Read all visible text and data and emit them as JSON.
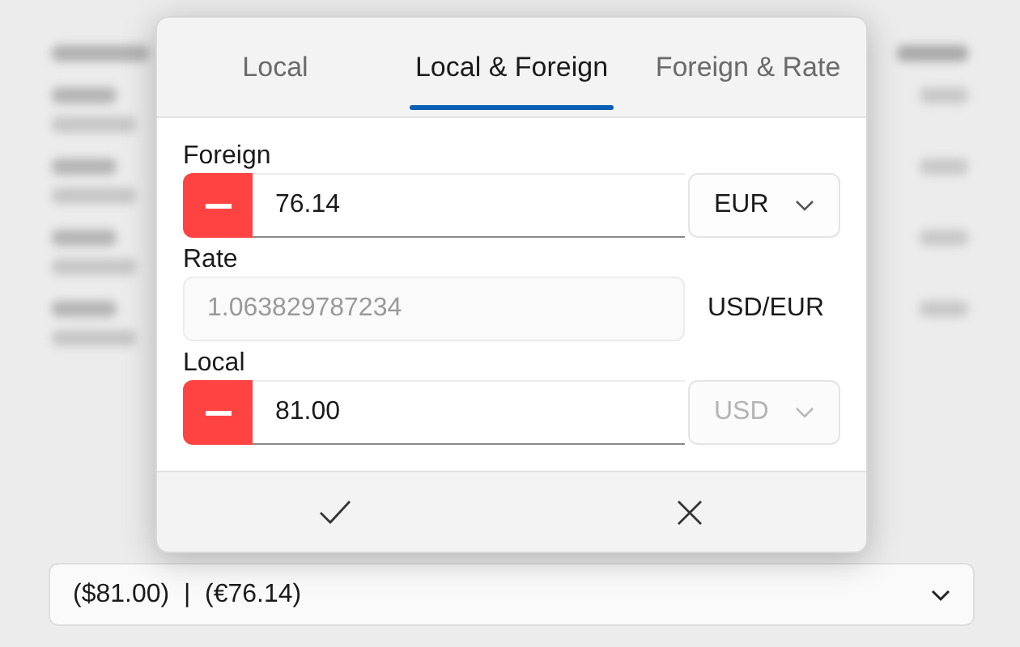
{
  "dialog": {
    "tabs": [
      {
        "label": "Local",
        "selected": false
      },
      {
        "label": "Local & Foreign",
        "selected": true
      },
      {
        "label": "Foreign & Rate",
        "selected": false
      }
    ],
    "fields": [
      {
        "kind": "amount",
        "label": "Foreign",
        "negative": true,
        "value": "76.14",
        "currency": "EUR",
        "disabled": false
      },
      {
        "kind": "rate",
        "label": "Rate",
        "value": "1.063829787234",
        "disabled": true,
        "unit": "USD/EUR"
      },
      {
        "kind": "amount",
        "label": "Local",
        "negative": true,
        "value": "81.00",
        "currency": "USD",
        "disabled": true
      }
    ]
  },
  "amount_dropdown": {
    "value": "($81.00)  |  (€76.14)"
  }
}
